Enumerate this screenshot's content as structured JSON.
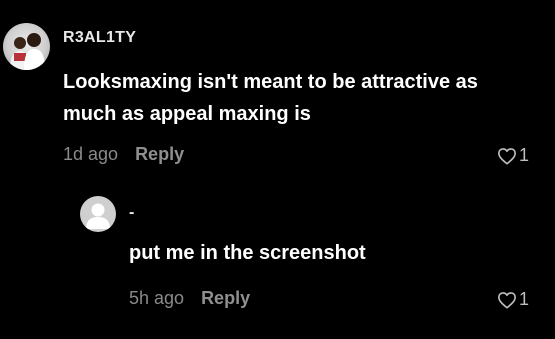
{
  "comments": [
    {
      "username": "R3AL1TY",
      "text": "Looksmaxing isn't meant to be attractive as much as appeal maxing is",
      "time": "1d ago",
      "reply_label": "Reply",
      "likes": "1",
      "avatar": "profile-photo"
    }
  ],
  "replies": [
    {
      "username": "-",
      "text": "put me in the screenshot",
      "time": "5h ago",
      "reply_label": "Reply",
      "likes": "1",
      "avatar": "default-avatar"
    }
  ],
  "colors": {
    "background": "#000000",
    "primary_text": "#ffffff",
    "secondary_text": "#8a8a8a",
    "avatar_placeholder": "#cfcfcf"
  },
  "icons": [
    "heart-outline-icon",
    "default-avatar-icon"
  ]
}
